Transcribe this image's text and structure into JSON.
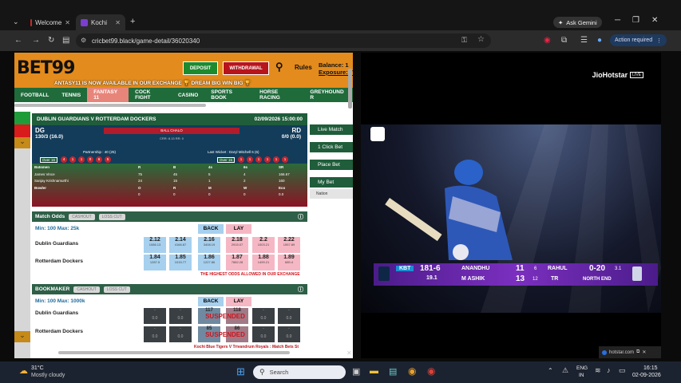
{
  "browser": {
    "tabs": [
      {
        "label": "Welcome",
        "active": false
      },
      {
        "label": "Kochi",
        "active": true
      }
    ],
    "ask_label": "Ask Gemini",
    "url": "cricbet99.black/game-detail/36020340",
    "action_label": "Action required"
  },
  "site": {
    "logo": "BET99",
    "deposit_label": "DEPOSIT",
    "withdrawal_label": "WITHDRAWAL",
    "rules_label": "Rules",
    "balance_label": "Balance: 1",
    "exposure_label": "Exposure: 7",
    "marquee": "ANTASY11 IS NOW AVAILABLE IN OUR EXCHANGE 🏆 DREAM BIG WIN BIG 🏆",
    "menu": [
      "FOOTBALL",
      "TENNIS",
      "FANTASY 11",
      "COCK FIGHT",
      "CASINO",
      "SPORTS BOOK",
      "HORSE RACING",
      "GREYHOUND R"
    ]
  },
  "match": {
    "title": "DUBLIN GUARDIANS V ROTTERDAM DOCKERS",
    "datetime": "02/09/2026 15:00:00",
    "team1_code": "DG",
    "team1_score": "130/3 (16.0)",
    "team2_code": "RD",
    "team2_score": "0/0 (0.0)",
    "ball_status": "BALL CHALO",
    "crr": "CRR: 8.13 RR: 0",
    "partnership": "Partnership : 40 (25)",
    "last_wicket": "Last Wicket : Daryl Mitchell 6 (6)",
    "over_left": "Over 16",
    "over_right": "Over 15",
    "balls_left": [
      "4",
      "1",
      "1",
      "0",
      "6",
      "6"
    ],
    "balls_right": [
      "1",
      "1",
      "1",
      "1",
      "1",
      "1"
    ],
    "bat_headers": [
      "Batsmen",
      "R",
      "B",
      "4s",
      "6s",
      "SR"
    ],
    "batsmen": [
      {
        "name": "James Vince",
        "r": "75",
        "b": "45",
        "f": "5",
        "s": "4",
        "sr": "166.67"
      },
      {
        "name": "Sanjay Krishnamurthi",
        "r": "24",
        "b": "15",
        "f": "1",
        "s": "2",
        "sr": "160"
      }
    ],
    "bowl_headers": [
      "Bowler",
      "O",
      "R",
      "M",
      "W",
      "Eco"
    ],
    "bowler": {
      "name": "",
      "o": "0",
      "r": "0",
      "m": "0",
      "w": "0",
      "eco": "0.0"
    }
  },
  "match_odds": {
    "title": "Match Odds",
    "cashout": "CASHOUT",
    "loss_cut": "LOSS CUT",
    "limits": "Min: 100 Max: 25k",
    "back": "BACK",
    "lay": "LAY",
    "rows": [
      {
        "name": "Dublin Guardians",
        "odds": [
          [
            "2.12",
            "1086.13"
          ],
          [
            "2.14",
            "4166.87"
          ],
          [
            "2.16",
            "3408.19"
          ],
          [
            "2.18",
            "2915.07"
          ],
          [
            "2.2",
            "1003.21"
          ],
          [
            "2.22",
            "1557.89"
          ]
        ]
      },
      {
        "name": "Rotterdam Dockers",
        "odds": [
          [
            "1.84",
            "1287.5"
          ],
          [
            "1.85",
            "1015.77"
          ],
          [
            "1.86",
            "1227.86"
          ],
          [
            "1.87",
            "7882.28"
          ],
          [
            "1.88",
            "1499.21"
          ],
          [
            "1.89",
            "689.4"
          ]
        ]
      }
    ],
    "note": "THE HIGHEST ODDS ALLOWED IN OUR EXCHANGE"
  },
  "bookmaker": {
    "title": "BOOKMAKER",
    "cashout": "CASHOUT",
    "loss_cut": "LOSS CUT",
    "limits": "Min: 100 Max: 1000k",
    "back": "BACK",
    "lay": "LAY",
    "rows": [
      {
        "name": "Dublin Guardians"
      },
      {
        "name": "Rotterdam Dockers"
      }
    ],
    "suspended": "SUSPENDED",
    "cell_top": "-",
    "cell_bottom": "0.0",
    "center_left": "117",
    "center_right": "118",
    "center_left_2": "85",
    "center_right_2": "86",
    "ticker": "Kochi Blue Tigers V Trivandrum Royals : Match Bets St"
  },
  "right_panel": [
    "Live Match",
    "1 Click Bet",
    "Place Bet",
    "My Bet"
  ],
  "nation_label": "Nation",
  "stream": {
    "brand": "JioHotstar",
    "live": "LIVE",
    "team": "KBT",
    "score": "181-6",
    "overs": "19.1",
    "bat1": "ANANDHU",
    "bat1_runs": "11",
    "bat1_balls": "6",
    "bat2": "M ASHIK",
    "bat2_runs": "13",
    "bat2_balls": "12",
    "bowler": "RAHUL",
    "bowler_fig": "0-20",
    "bowler_overs": "3.1",
    "opp": "TR",
    "end": "NORTH END",
    "pip_label": "hotstar.com"
  },
  "taskbar": {
    "temp": "31°C",
    "weather": "Mostly cloudy",
    "search": "Search",
    "lang1": "ENG",
    "lang2": "IN",
    "time": "16:15",
    "date": "02-09-2026"
  }
}
